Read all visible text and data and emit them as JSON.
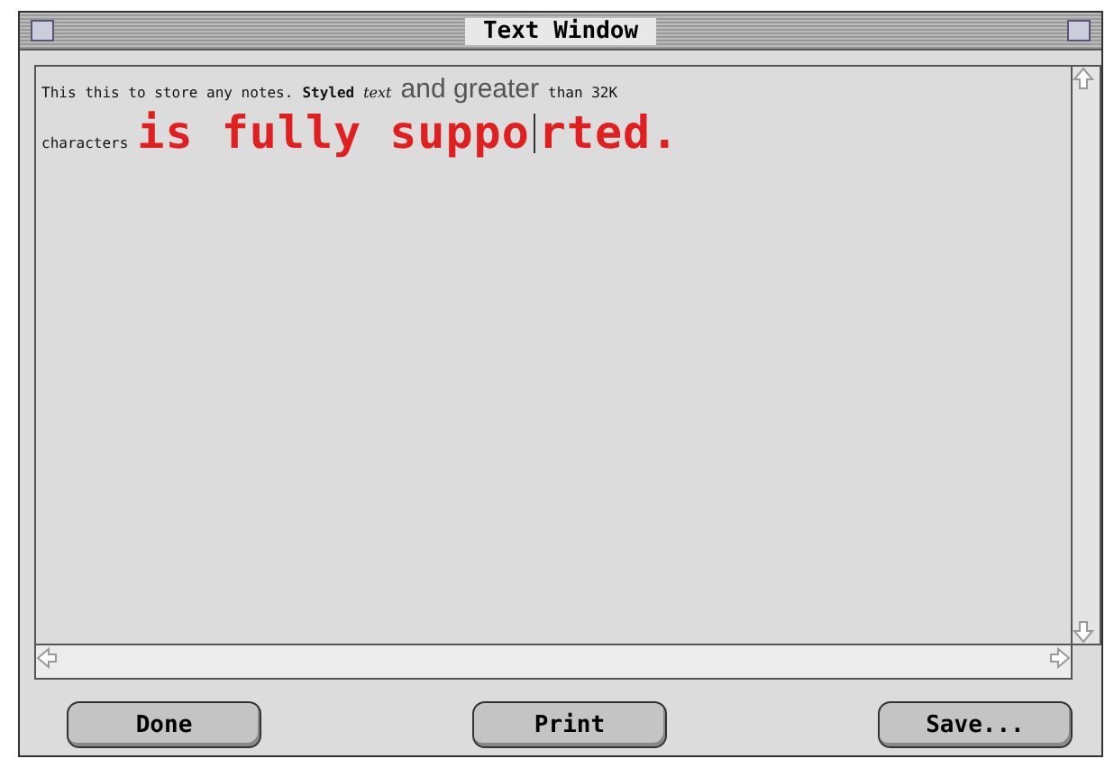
{
  "window": {
    "title": "Text Window"
  },
  "text": {
    "lines": [
      [
        {
          "kind": "plain",
          "text": "This this to store any notes."
        },
        {
          "kind": "bold",
          "text": "Styled"
        },
        {
          "kind": "italic",
          "text": "text"
        },
        {
          "kind": "sans",
          "text": "and greater"
        },
        {
          "kind": "plain",
          "text": "than 32K"
        }
      ],
      [
        {
          "kind": "plain",
          "text": "characters"
        },
        {
          "kind": "red",
          "text": "is fully suppo"
        },
        {
          "kind": "caret"
        },
        {
          "kind": "red",
          "text": "rted"
        },
        {
          "kind": "red",
          "text": "."
        }
      ]
    ]
  },
  "buttons": [
    "Done",
    "Print",
    "Save..."
  ]
}
